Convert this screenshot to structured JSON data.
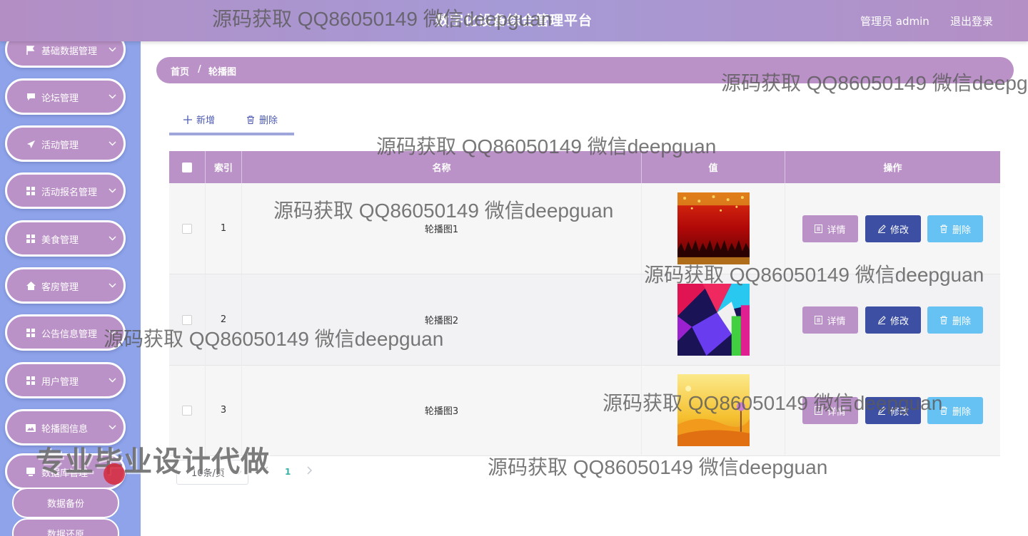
{
  "header": {
    "title": "数字化设备综合管理平台",
    "user_label": "管理员 admin",
    "logout_label": "退出登录"
  },
  "sidebar": {
    "items": [
      {
        "label": "基础数据管理",
        "icon": "flag-icon"
      },
      {
        "label": "论坛管理",
        "icon": "comment-icon"
      },
      {
        "label": "活动管理",
        "icon": "send-icon"
      },
      {
        "label": "活动报名管理",
        "icon": "grid-icon"
      },
      {
        "label": "美食管理",
        "icon": "grid-icon"
      },
      {
        "label": "客房管理",
        "icon": "home-icon"
      },
      {
        "label": "公告信息管理",
        "icon": "grid-icon"
      },
      {
        "label": "用户管理",
        "icon": "grid-icon"
      },
      {
        "label": "轮播图信息",
        "icon": "image-icon"
      },
      {
        "label": "数据库管理",
        "icon": "database-icon"
      }
    ],
    "sub_items": [
      {
        "label": "数据备份"
      },
      {
        "label": "数据还原"
      }
    ]
  },
  "breadcrumb": {
    "home": "首页",
    "sep": "/",
    "current": "轮播图"
  },
  "toolbar": {
    "add_label": "新增",
    "delete_label": "删除"
  },
  "table": {
    "columns": [
      "索引",
      "名称",
      "值",
      "操作"
    ],
    "rows": [
      {
        "index": "1",
        "name": "轮播图1",
        "image": "red-stage"
      },
      {
        "index": "2",
        "name": "轮播图2",
        "image": "colorful-geometric"
      },
      {
        "index": "3",
        "name": "轮播图3",
        "image": "autumn-landscape"
      }
    ],
    "actions": {
      "detail": "详情",
      "edit": "修改",
      "delete": "删除"
    }
  },
  "pagination": {
    "page_size": "10条/页",
    "current_page": "1"
  },
  "watermarks": {
    "text": "源码获取 QQ86050149 微信deepguan",
    "stamp": "专业毕业设计代做"
  },
  "colors": {
    "header": "#b38ec4",
    "sidebar_bg": "#8ea3ea",
    "accent_purple": "#bb92c7",
    "edit_blue": "#3d4fa3",
    "delete_sky": "#67c2f4",
    "page_active": "#38b1a7"
  }
}
